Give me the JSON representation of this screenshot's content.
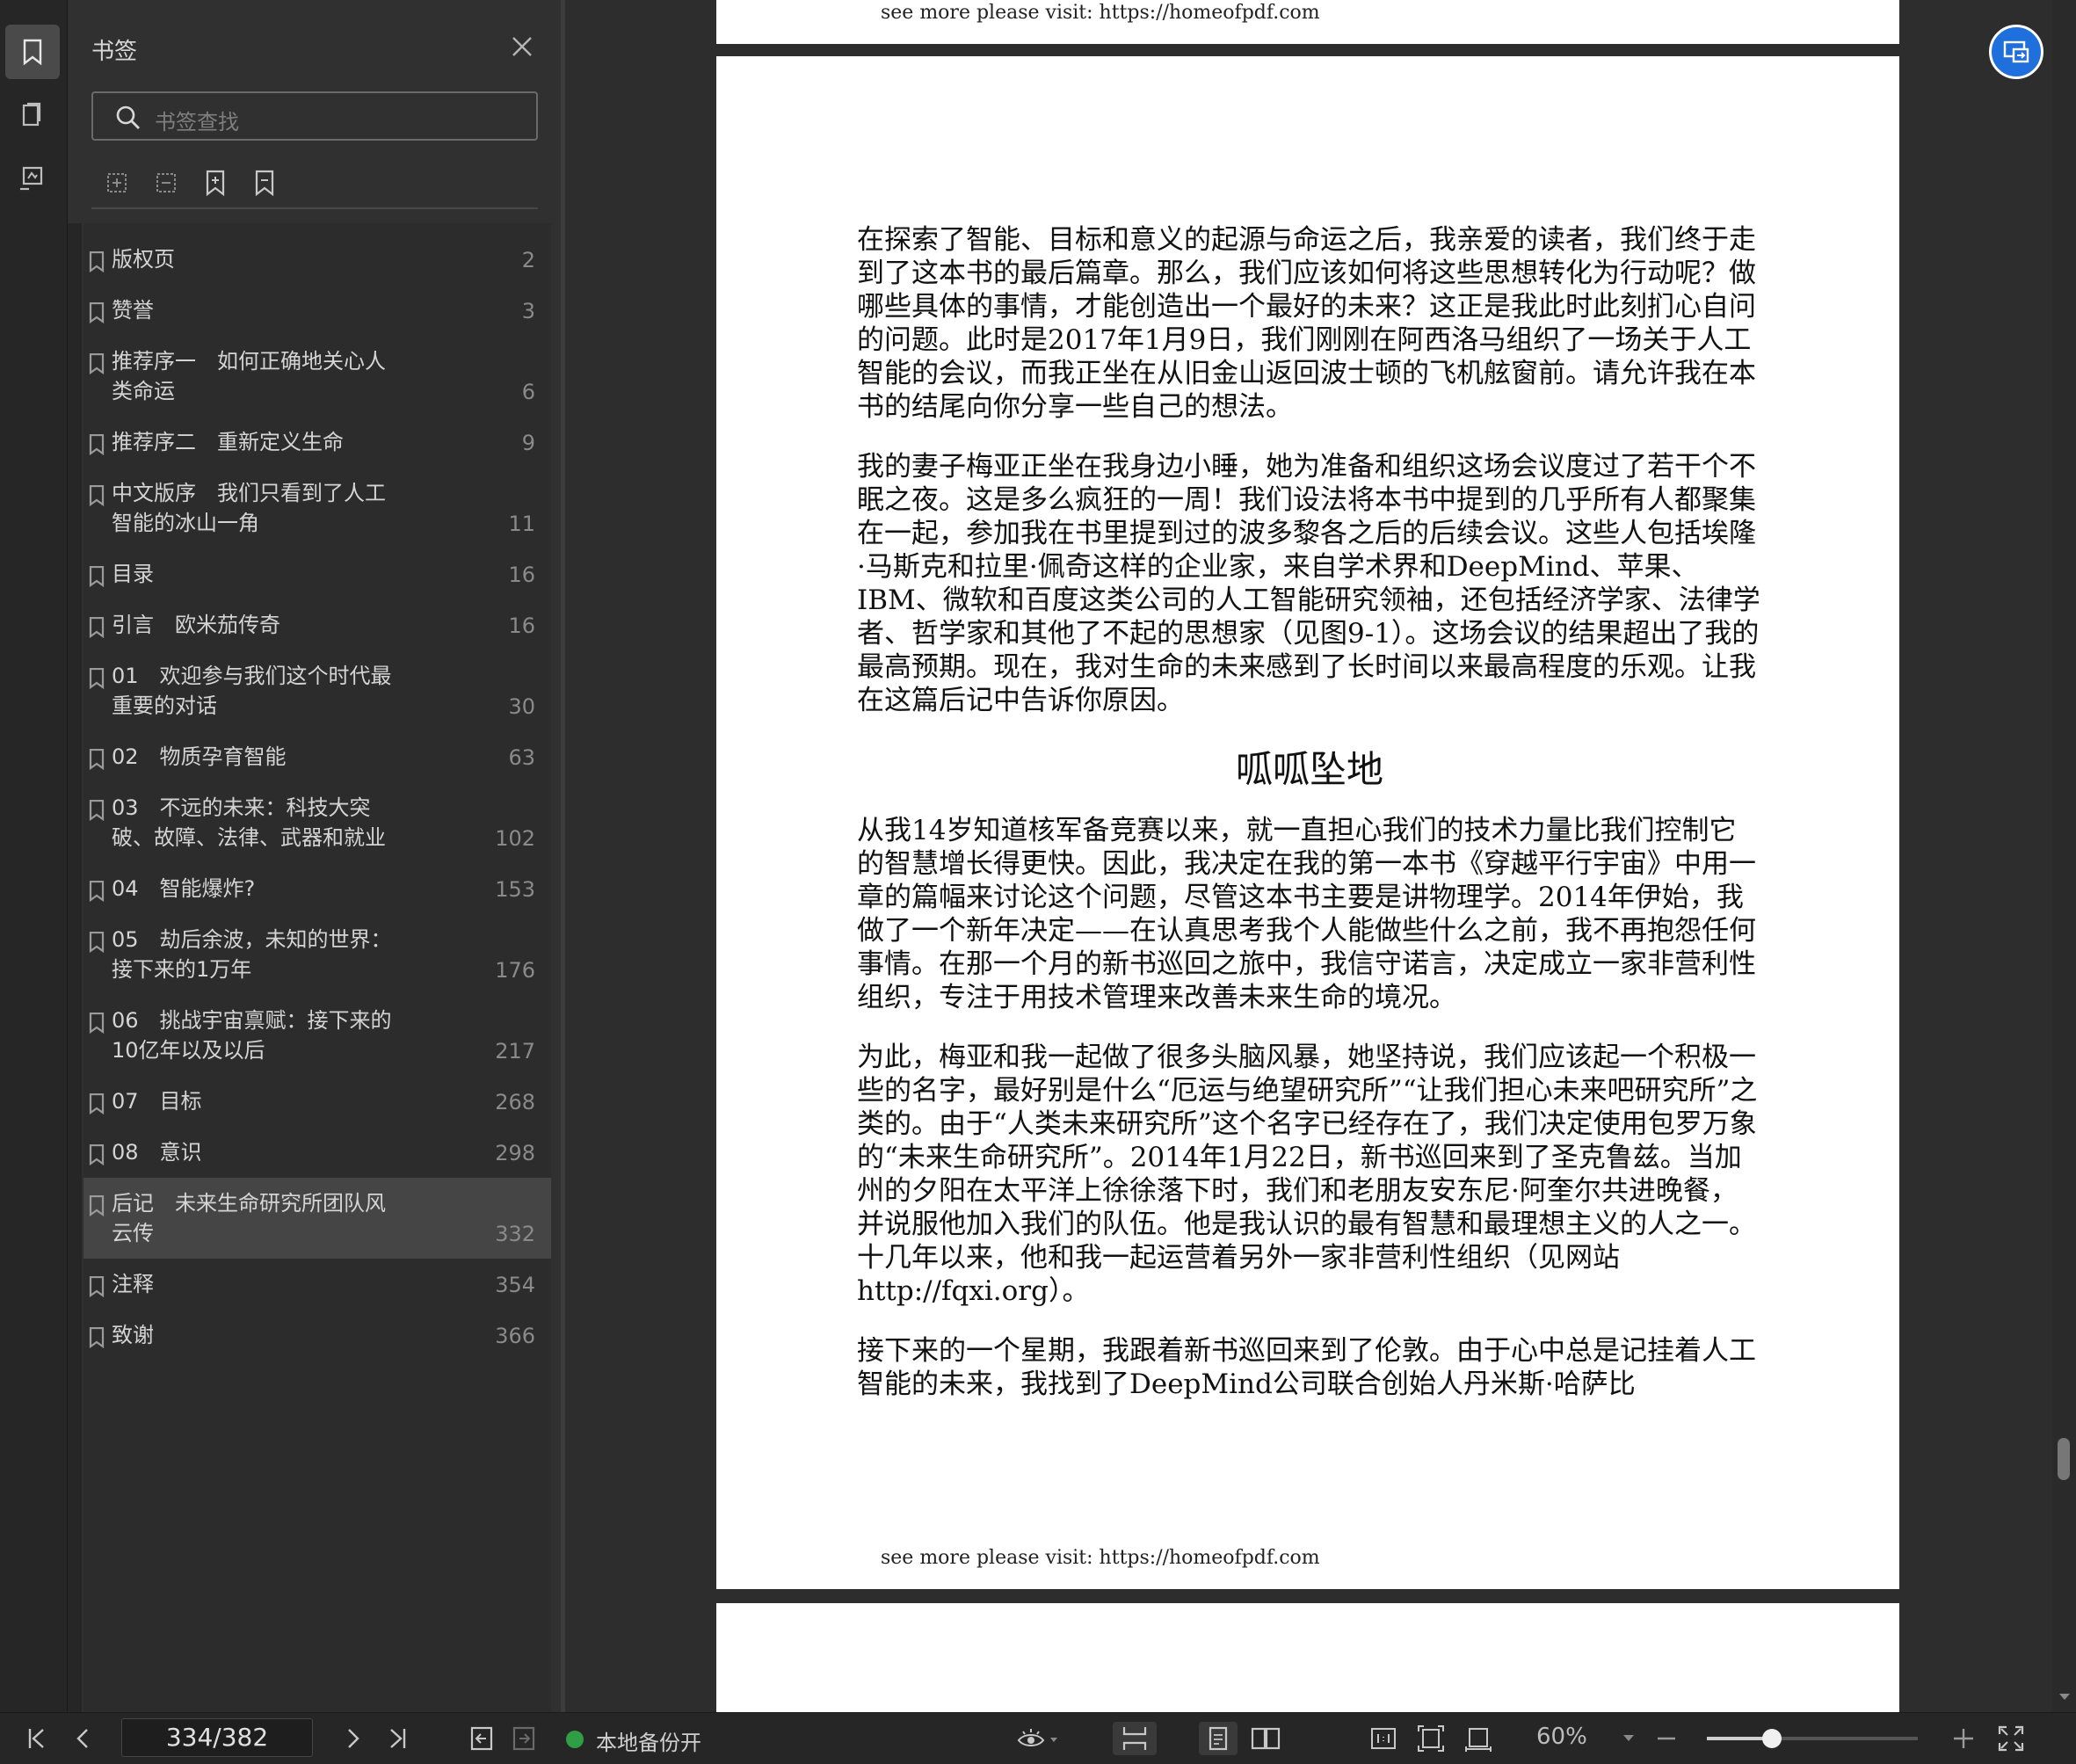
{
  "sidebar": {
    "title": "书签",
    "search_placeholder": "书签查找",
    "items": [
      {
        "label": "版权页",
        "page": "2"
      },
      {
        "label": "赞誉",
        "page": "3"
      },
      {
        "label": "推荐序一　如何正确地关心人类命运",
        "page": "6"
      },
      {
        "label": "推荐序二　重新定义生命",
        "page": "9"
      },
      {
        "label": "中文版序　我们只看到了人工智能的冰山一角",
        "page": "11"
      },
      {
        "label": "目录",
        "page": "16"
      },
      {
        "label": "引言　欧米茄传奇",
        "page": "16"
      },
      {
        "label": "01　欢迎参与我们这个时代最重要的对话",
        "page": "30"
      },
      {
        "label": "02　物质孕育智能",
        "page": "63"
      },
      {
        "label": "03　不远的未来：科技大突破、故障、法律、武器和就业",
        "page": "102"
      },
      {
        "label": "04　智能爆炸?",
        "page": "153"
      },
      {
        "label": "05　劫后余波，未知的世界：接下来的1万年",
        "page": "176"
      },
      {
        "label": "06　挑战宇宙禀赋：接下来的10亿年以及以后",
        "page": "217"
      },
      {
        "label": "07　目标",
        "page": "268"
      },
      {
        "label": "08　意识",
        "page": "298"
      },
      {
        "label": "后记　未来生命研究所团队风云传",
        "page": "332",
        "selected": true
      },
      {
        "label": "注释",
        "page": "354"
      },
      {
        "label": "致谢",
        "page": "366"
      }
    ]
  },
  "document": {
    "header_footer": "see more please visit: https://homeofpdf.com",
    "paragraphs_a": [
      "在探索了智能、目标和意义的起源与命运之后，我亲爱的读者，我们终于走到了这本书的最后篇章。那么，我们应该如何将这些思想转化为行动呢？做哪些具体的事情，才能创造出一个最好的未来？这正是我此时此刻扪心自问的问题。此时是2017年1月9日，我们刚刚在阿西洛马组织了一场关于人工智能的会议，而我正坐在从旧金山返回波士顿的飞机舷窗前。请允许我在本书的结尾向你分享一些自己的想法。",
      "我的妻子梅亚正坐在我身边小睡，她为准备和组织这场会议度过了若干个不眠之夜。这是多么疯狂的一周！我们设法将本书中提到的几乎所有人都聚集在一起，参加我在书里提到过的波多黎各之后的后续会议。这些人包括埃隆·马斯克和拉里·佩奇这样的企业家，来自学术界和DeepMind、苹果、IBM、微软和百度这类公司的人工智能研究领袖，还包括经济学家、法律学者、哲学家和其他了不起的思想家（见图9-1）。这场会议的结果超出了我的最高预期。现在，我对生命的未来感到了长时间以来最高程度的乐观。让我在这篇后记中告诉你原因。"
    ],
    "heading": "呱呱坠地",
    "paragraphs_b": [
      "从我14岁知道核军备竞赛以来，就一直担心我们的技术力量比我们控制它的智慧增长得更快。因此，我决定在我的第一本书《穿越平行宇宙》中用一章的篇幅来讨论这个问题，尽管这本书主要是讲物理学。2014年伊始，我做了一个新年决定——在认真思考我个人能做些什么之前，我不再抱怨任何事情。在那一个月的新书巡回之旅中，我信守诺言，决定成立一家非营利性组织，专注于用技术管理来改善未来生命的境况。",
      "为此，梅亚和我一起做了很多头脑风暴，她坚持说，我们应该起一个积极一些的名字，最好别是什么“厄运与绝望研究所”“让我们担心未来吧研究所”之类的。由于“人类未来研究所”这个名字已经存在了，我们决定使用包罗万象的“未来生命研究所”。2014年1月22日，新书巡回来到了圣克鲁兹。当加州的夕阳在太平洋上徐徐落下时，我们和老朋友安东尼·阿奎尔共进晚餐，并说服他加入我们的队伍。他是我认识的最有智慧和最理想主义的人之一。十几年以来，他和我一起运营着另外一家非营利性组织（见网站http://fqxi.org）。",
      "接下来的一个星期，我跟着新书巡回来到了伦敦。由于心中总是记挂着人工智能的未来，我找到了DeepMind公司联合创始人丹米斯·哈萨比"
    ]
  },
  "status": {
    "page_indicator": "334/382",
    "backup_label": "本地备份开",
    "zoom_label": "60%",
    "zoom_fraction": 0.31,
    "accent": "#1f6fdc",
    "backup_color": "#2f9e44"
  }
}
